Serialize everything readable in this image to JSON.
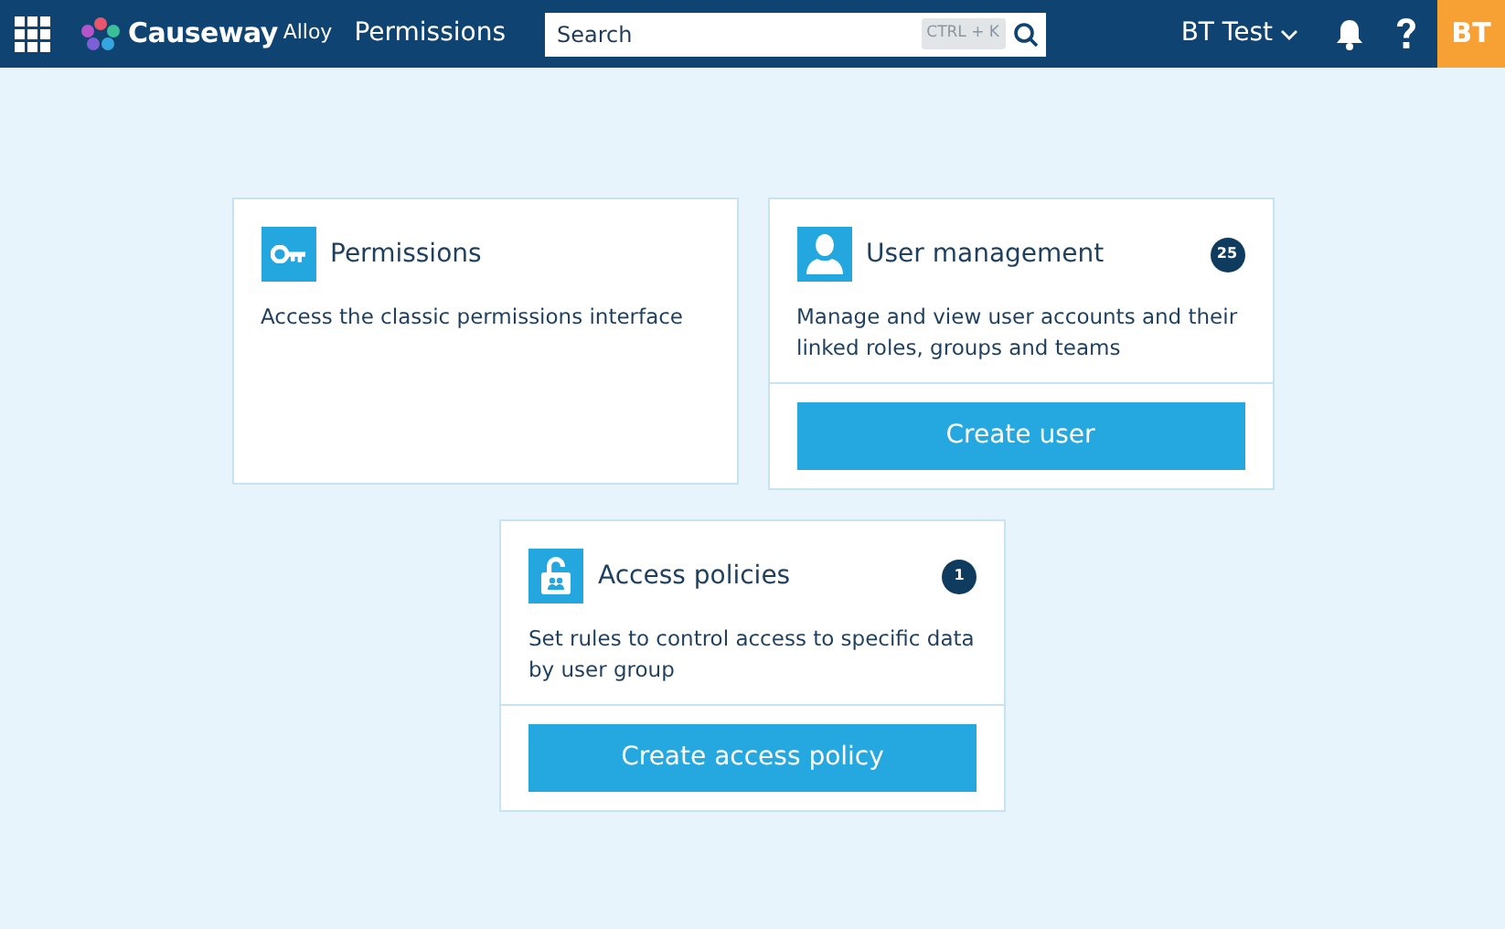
{
  "header": {
    "brand": "Causeway",
    "brand_suffix": "Alloy",
    "page_title": "Permissions",
    "search": {
      "placeholder": "Search",
      "shortcut": "CTRL + K"
    },
    "user_menu": "BT Test",
    "avatar": "BT"
  },
  "cards": [
    {
      "kind": "key",
      "title": "Permissions",
      "description": "Access the classic permissions interface"
    },
    {
      "kind": "user",
      "title": "User management",
      "badge": "25",
      "description": "Manage and view user accounts and their linked roles, groups and teams",
      "button": "Create user"
    },
    {
      "kind": "lock",
      "title": "Access policies",
      "badge": "1",
      "description": "Set rules to control access to specific data by user group",
      "button": "Create access policy"
    }
  ]
}
